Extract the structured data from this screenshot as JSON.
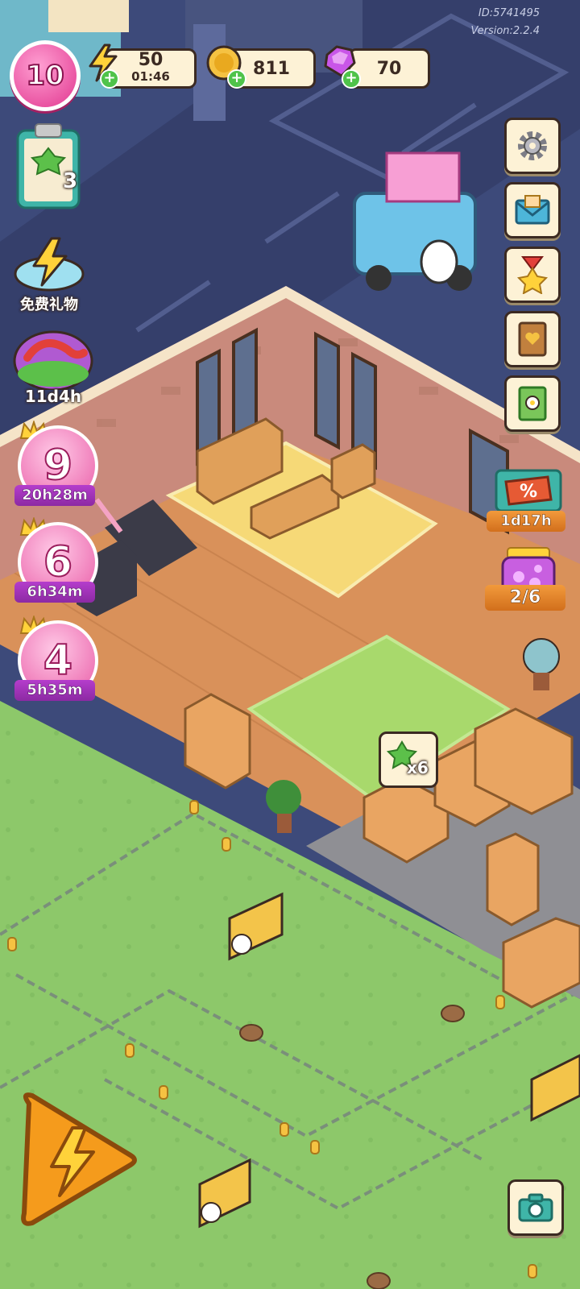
{
  "hud": {
    "level": "10",
    "energy": {
      "value": "50",
      "timer": "01:46"
    },
    "coins": {
      "value": "811"
    },
    "gems": {
      "value": "70"
    },
    "meta": {
      "id": "ID:5741495",
      "version": "Version:2.2.4"
    }
  },
  "left_panel": {
    "quest_count": "3",
    "free_gift_label": "免费礼物",
    "event_timer": "11d4h",
    "boost_events": [
      {
        "number": "9",
        "timer": "20h28m"
      },
      {
        "number": "6",
        "timer": "6h34m"
      },
      {
        "number": "4",
        "timer": "5h35m"
      }
    ]
  },
  "right_panel": {
    "buttons": [
      "gear-icon",
      "mail-icon",
      "medal-icon",
      "heart-book-icon",
      "recipe-book-icon"
    ],
    "sale_timer": "1d17h",
    "jar_progress": "2/6"
  },
  "scene": {
    "clover_reward": "x6"
  },
  "colors": {
    "accent_pink": "#e1368f",
    "hud_border": "#3b2a22",
    "pill_bg": "#fdf2d6",
    "grass": "#8dc86a",
    "asphalt": "#3d4a7a"
  }
}
